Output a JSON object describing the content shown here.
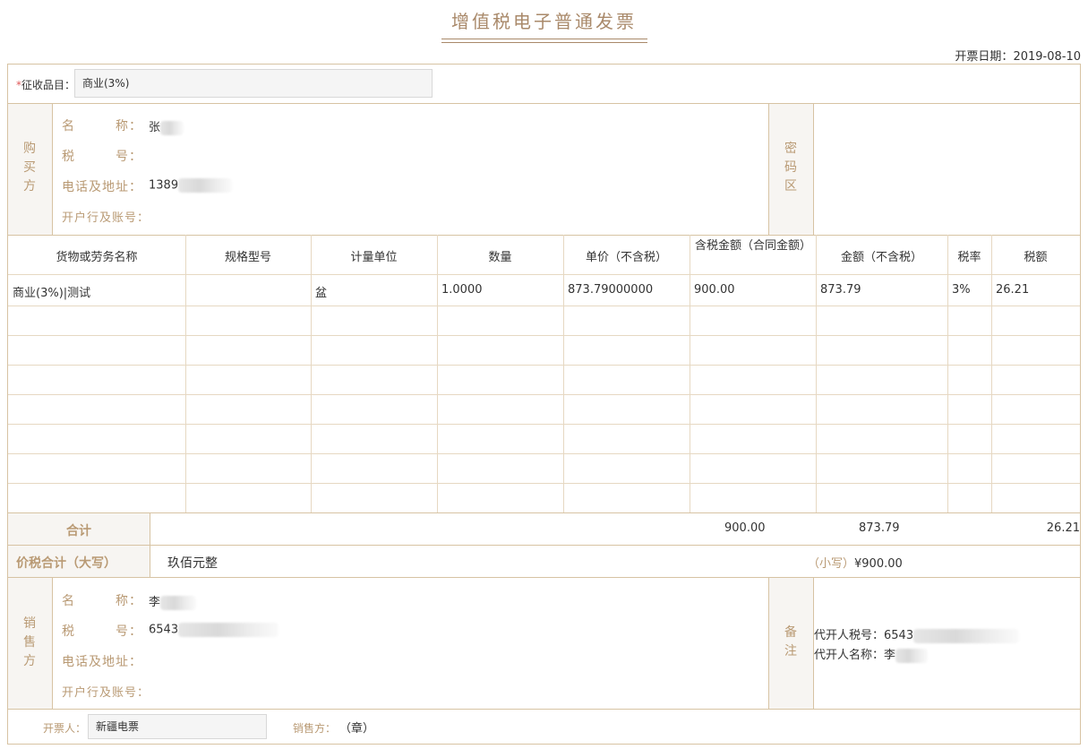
{
  "invoice": {
    "title": "增值税电子普通发票",
    "date_label": "开票日期：",
    "date": "2019-08-10"
  },
  "category": {
    "required_mark": "*",
    "label": "征收品目：",
    "value": "商业(3%)"
  },
  "buyer": {
    "side_label": [
      "购",
      "买",
      "方"
    ],
    "name_label": "名　　　称：",
    "name_value": "张",
    "tax_label": "税　　　号：",
    "tax_value": "",
    "addr_label": "电话及地址：",
    "addr_value": "1389",
    "bank_label": "开户行及账号：",
    "bank_value": ""
  },
  "cipher": {
    "side_label": [
      "密",
      "码",
      "区"
    ]
  },
  "table": {
    "headers": [
      "货物或劳务名称",
      "规格型号",
      "计量单位",
      "数量",
      "单价（不含税）",
      "含税金额（合同金额）",
      "金额（不含税）",
      "税率",
      "税额"
    ],
    "rows": [
      [
        "商业(3%)|测试",
        "",
        "盆",
        "1.0000",
        "873.79000000",
        "900.00",
        "873.79",
        "3%",
        "26.21"
      ]
    ]
  },
  "totals": {
    "label": "合计",
    "amount_with_tax": "900.00",
    "amount": "873.79",
    "tax": "26.21"
  },
  "grand_total": {
    "label": "价税合计（大写）",
    "words": "玖佰元整",
    "small_label": "（小写）",
    "small_value": "¥900.00"
  },
  "seller": {
    "side_label": [
      "销",
      "售",
      "方"
    ],
    "name_label": "名　　　称：",
    "name_value": "李",
    "tax_label": "税　　　号：",
    "tax_value": "6543",
    "addr_label": "电话及地址：",
    "addr_value": "",
    "bank_label": "开户行及账号：",
    "bank_value": ""
  },
  "remarks": {
    "side_label": [
      "备",
      "注"
    ],
    "agent_tax_label": "代开人税号：",
    "agent_tax_value": "6543",
    "agent_name_label": "代开人名称：",
    "agent_name_value": "李"
  },
  "footer": {
    "issuer_label": "开票人：",
    "issuer_value": "新疆电票",
    "seller_label": "销售方：",
    "seal": "（章）"
  }
}
